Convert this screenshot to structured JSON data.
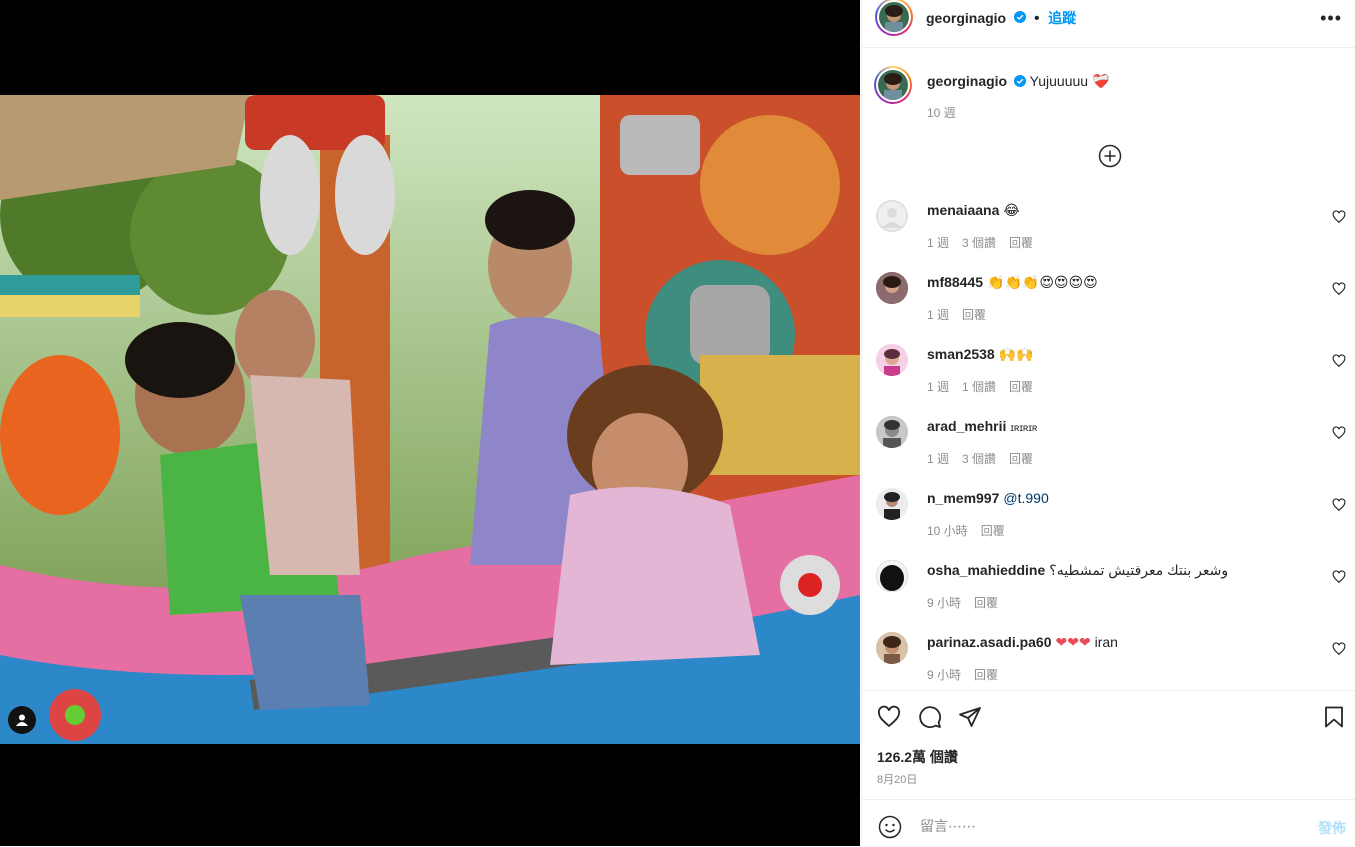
{
  "post": {
    "username": "georginagio",
    "follow_label": "追蹤",
    "more_icon": "more-icon",
    "caption_text": "Yujuuuuu",
    "caption_emoji": "❤️‍🩹",
    "caption_time": "10 週"
  },
  "comments": [
    {
      "username": "menaiaana",
      "text": "😂",
      "time": "1 週",
      "likes": "3 個讚",
      "reply": "回覆"
    },
    {
      "username": "mf88445",
      "text": "👏👏👏😍😍😍😍",
      "time": "1 週",
      "likes": "",
      "reply": "回覆"
    },
    {
      "username": "sman2538",
      "text": "🙌🙌",
      "time": "1 週",
      "likes": "1 個讚",
      "reply": "回覆"
    },
    {
      "username": "arad_mehrii",
      "text": "ɪʀɪʀɪʀ",
      "time": "1 週",
      "likes": "3 個讚",
      "reply": "回覆"
    },
    {
      "username": "n_mem997",
      "text": "@t.990",
      "time": "10 小時",
      "likes": "",
      "reply": "回覆"
    },
    {
      "username": "osha_mahieddine",
      "text": "وشعر بنتك معرفتيش تمشطيه؟",
      "time": "9 小時",
      "likes": "",
      "reply": "回覆"
    },
    {
      "username": "parinaz.asadi.pa60",
      "text": "❤❤❤ iran",
      "time": "9 小時",
      "likes": "",
      "reply": "回覆"
    }
  ],
  "stats": {
    "likes": "126.2萬 個讚",
    "date": "8月20日"
  },
  "comment_box": {
    "placeholder": "留言⋯⋯",
    "post_label": "發佈"
  },
  "colors": {
    "link_blue": "#0095f6",
    "mention_blue": "#00376b",
    "muted": "#8e8e8e",
    "heart_red": "#ed4956"
  }
}
